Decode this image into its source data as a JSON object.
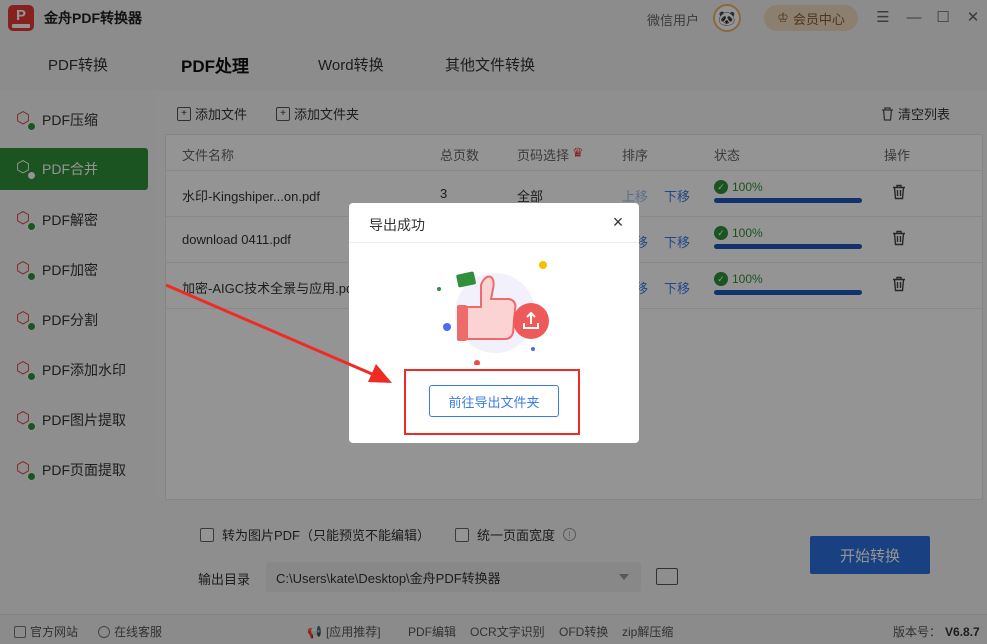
{
  "app": {
    "title": "金舟PDF转换器",
    "logo_letter": "P",
    "user": "微信用户",
    "vip": "会员中心"
  },
  "nav": {
    "tabs": [
      "PDF转换",
      "PDF处理",
      "Word转换",
      "其他文件转换"
    ]
  },
  "sidebar": {
    "items": [
      "PDF压缩",
      "PDF合并",
      "PDF解密",
      "PDF加密",
      "PDF分割",
      "PDF添加水印",
      "PDF图片提取",
      "PDF页面提取"
    ]
  },
  "toolbar": {
    "add_file": "添加文件",
    "add_folder": "添加文件夹",
    "clear": "清空列表"
  },
  "table": {
    "headers": {
      "name": "文件名称",
      "pages": "总页数",
      "range": "页码选择",
      "order": "排序",
      "status": "状态",
      "action": "操作"
    },
    "rows": [
      {
        "name": "水印-Kingshiper...on.pdf",
        "pages": "3",
        "range": "全部",
        "up": "上移",
        "down": "下移",
        "progress_text": "100%",
        "progress": 1.0
      },
      {
        "name": "download 0411.pdf",
        "pages": "",
        "range": "",
        "up": "上移",
        "down": "下移",
        "progress_text": "100%",
        "progress": 1.0
      },
      {
        "name": "加密-AIGC技术全景与应用.pdf",
        "pages": "",
        "range": "",
        "up": "上移",
        "down": "下移",
        "progress_text": "100%",
        "progress": 1.0
      }
    ]
  },
  "options": {
    "to_image": "转为图片PDF（只能预览不能编辑）",
    "uniform_width": "统一页面宽度",
    "output_label": "输出目录",
    "output_path": "C:\\Users\\kate\\Desktop\\金舟PDF转换器",
    "start": "开始转换"
  },
  "footer": {
    "website": "官方网站",
    "service": "在线客服",
    "recommend": "[应用推荐]",
    "pdf_edit": "PDF编辑",
    "ocr": "OCR文字识别",
    "ofd": "OFD转换",
    "zip": "zip解压缩",
    "version_label": "版本号：",
    "version": "V6.8.7"
  },
  "dialog": {
    "title": "导出成功",
    "button": "前往导出文件夹"
  },
  "colors": {
    "accent_green": "#2f8f3a",
    "accent_blue": "#2b6ede",
    "annotation_red": "#ee2b24"
  }
}
